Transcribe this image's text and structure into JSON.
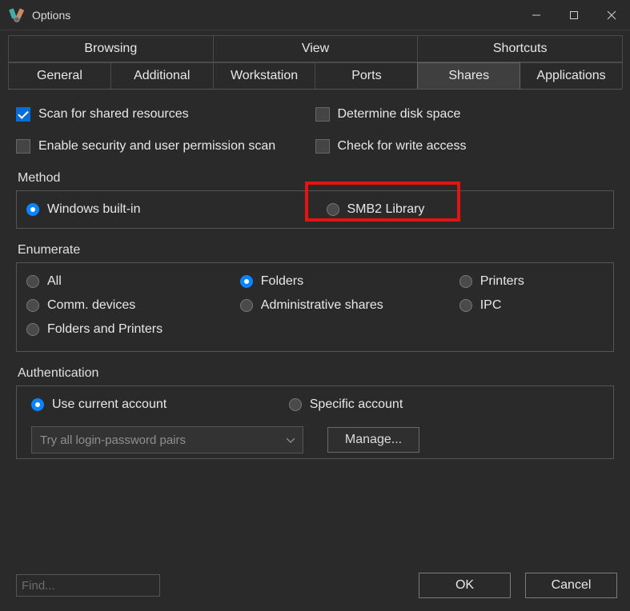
{
  "titlebar": {
    "title": "Options"
  },
  "tabs_row1": [
    {
      "label": "Browsing"
    },
    {
      "label": "View"
    },
    {
      "label": "Shortcuts"
    }
  ],
  "tabs_row2": [
    {
      "label": "General"
    },
    {
      "label": "Additional"
    },
    {
      "label": "Workstation"
    },
    {
      "label": "Ports"
    },
    {
      "label": "Shares",
      "active": true
    },
    {
      "label": "Applications"
    }
  ],
  "checkboxes": {
    "scan_shared": {
      "label": "Scan for shared resources",
      "checked": true
    },
    "determine_disk": {
      "label": "Determine disk space",
      "checked": false
    },
    "enable_security": {
      "label": "Enable security and user permission scan",
      "checked": false
    },
    "check_write": {
      "label": "Check for write access",
      "checked": false
    }
  },
  "method": {
    "title": "Method",
    "builtin": {
      "label": "Windows built-in",
      "selected": true
    },
    "smb2": {
      "label": "SMB2 Library",
      "selected": false,
      "highlighted": true
    }
  },
  "enumerate": {
    "title": "Enumerate",
    "all": {
      "label": "All"
    },
    "folders": {
      "label": "Folders",
      "selected": true
    },
    "printers": {
      "label": "Printers"
    },
    "comm": {
      "label": "Comm. devices"
    },
    "admin": {
      "label": "Administrative shares"
    },
    "ipc": {
      "label": "IPC"
    },
    "fandp": {
      "label": "Folders and Printers"
    }
  },
  "auth": {
    "title": "Authentication",
    "current": {
      "label": "Use current account",
      "selected": true
    },
    "specific": {
      "label": "Specific account"
    },
    "combo_placeholder": "Try all login-password pairs",
    "manage_label": "Manage..."
  },
  "footer": {
    "find_placeholder": "Find...",
    "ok": "OK",
    "cancel": "Cancel"
  }
}
